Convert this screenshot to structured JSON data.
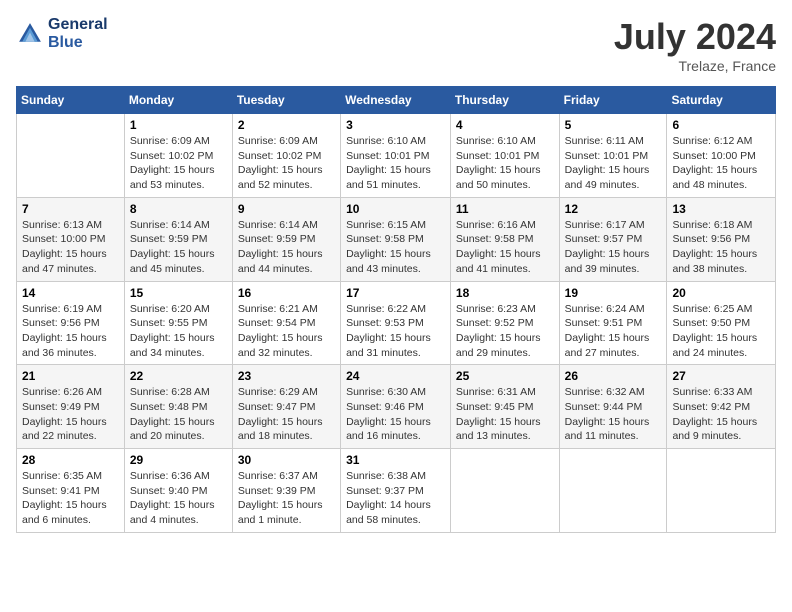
{
  "header": {
    "logo_line1": "General",
    "logo_line2": "Blue",
    "month_title": "July 2024",
    "location": "Trelaze, France"
  },
  "days_of_week": [
    "Sunday",
    "Monday",
    "Tuesday",
    "Wednesday",
    "Thursday",
    "Friday",
    "Saturday"
  ],
  "weeks": [
    [
      {
        "day": "",
        "info": ""
      },
      {
        "day": "1",
        "info": "Sunrise: 6:09 AM\nSunset: 10:02 PM\nDaylight: 15 hours\nand 53 minutes."
      },
      {
        "day": "2",
        "info": "Sunrise: 6:09 AM\nSunset: 10:02 PM\nDaylight: 15 hours\nand 52 minutes."
      },
      {
        "day": "3",
        "info": "Sunrise: 6:10 AM\nSunset: 10:01 PM\nDaylight: 15 hours\nand 51 minutes."
      },
      {
        "day": "4",
        "info": "Sunrise: 6:10 AM\nSunset: 10:01 PM\nDaylight: 15 hours\nand 50 minutes."
      },
      {
        "day": "5",
        "info": "Sunrise: 6:11 AM\nSunset: 10:01 PM\nDaylight: 15 hours\nand 49 minutes."
      },
      {
        "day": "6",
        "info": "Sunrise: 6:12 AM\nSunset: 10:00 PM\nDaylight: 15 hours\nand 48 minutes."
      }
    ],
    [
      {
        "day": "7",
        "info": "Sunrise: 6:13 AM\nSunset: 10:00 PM\nDaylight: 15 hours\nand 47 minutes."
      },
      {
        "day": "8",
        "info": "Sunrise: 6:14 AM\nSunset: 9:59 PM\nDaylight: 15 hours\nand 45 minutes."
      },
      {
        "day": "9",
        "info": "Sunrise: 6:14 AM\nSunset: 9:59 PM\nDaylight: 15 hours\nand 44 minutes."
      },
      {
        "day": "10",
        "info": "Sunrise: 6:15 AM\nSunset: 9:58 PM\nDaylight: 15 hours\nand 43 minutes."
      },
      {
        "day": "11",
        "info": "Sunrise: 6:16 AM\nSunset: 9:58 PM\nDaylight: 15 hours\nand 41 minutes."
      },
      {
        "day": "12",
        "info": "Sunrise: 6:17 AM\nSunset: 9:57 PM\nDaylight: 15 hours\nand 39 minutes."
      },
      {
        "day": "13",
        "info": "Sunrise: 6:18 AM\nSunset: 9:56 PM\nDaylight: 15 hours\nand 38 minutes."
      }
    ],
    [
      {
        "day": "14",
        "info": "Sunrise: 6:19 AM\nSunset: 9:56 PM\nDaylight: 15 hours\nand 36 minutes."
      },
      {
        "day": "15",
        "info": "Sunrise: 6:20 AM\nSunset: 9:55 PM\nDaylight: 15 hours\nand 34 minutes."
      },
      {
        "day": "16",
        "info": "Sunrise: 6:21 AM\nSunset: 9:54 PM\nDaylight: 15 hours\nand 32 minutes."
      },
      {
        "day": "17",
        "info": "Sunrise: 6:22 AM\nSunset: 9:53 PM\nDaylight: 15 hours\nand 31 minutes."
      },
      {
        "day": "18",
        "info": "Sunrise: 6:23 AM\nSunset: 9:52 PM\nDaylight: 15 hours\nand 29 minutes."
      },
      {
        "day": "19",
        "info": "Sunrise: 6:24 AM\nSunset: 9:51 PM\nDaylight: 15 hours\nand 27 minutes."
      },
      {
        "day": "20",
        "info": "Sunrise: 6:25 AM\nSunset: 9:50 PM\nDaylight: 15 hours\nand 24 minutes."
      }
    ],
    [
      {
        "day": "21",
        "info": "Sunrise: 6:26 AM\nSunset: 9:49 PM\nDaylight: 15 hours\nand 22 minutes."
      },
      {
        "day": "22",
        "info": "Sunrise: 6:28 AM\nSunset: 9:48 PM\nDaylight: 15 hours\nand 20 minutes."
      },
      {
        "day": "23",
        "info": "Sunrise: 6:29 AM\nSunset: 9:47 PM\nDaylight: 15 hours\nand 18 minutes."
      },
      {
        "day": "24",
        "info": "Sunrise: 6:30 AM\nSunset: 9:46 PM\nDaylight: 15 hours\nand 16 minutes."
      },
      {
        "day": "25",
        "info": "Sunrise: 6:31 AM\nSunset: 9:45 PM\nDaylight: 15 hours\nand 13 minutes."
      },
      {
        "day": "26",
        "info": "Sunrise: 6:32 AM\nSunset: 9:44 PM\nDaylight: 15 hours\nand 11 minutes."
      },
      {
        "day": "27",
        "info": "Sunrise: 6:33 AM\nSunset: 9:42 PM\nDaylight: 15 hours\nand 9 minutes."
      }
    ],
    [
      {
        "day": "28",
        "info": "Sunrise: 6:35 AM\nSunset: 9:41 PM\nDaylight: 15 hours\nand 6 minutes."
      },
      {
        "day": "29",
        "info": "Sunrise: 6:36 AM\nSunset: 9:40 PM\nDaylight: 15 hours\nand 4 minutes."
      },
      {
        "day": "30",
        "info": "Sunrise: 6:37 AM\nSunset: 9:39 PM\nDaylight: 15 hours\nand 1 minute."
      },
      {
        "day": "31",
        "info": "Sunrise: 6:38 AM\nSunset: 9:37 PM\nDaylight: 14 hours\nand 58 minutes."
      },
      {
        "day": "",
        "info": ""
      },
      {
        "day": "",
        "info": ""
      },
      {
        "day": "",
        "info": ""
      }
    ]
  ]
}
